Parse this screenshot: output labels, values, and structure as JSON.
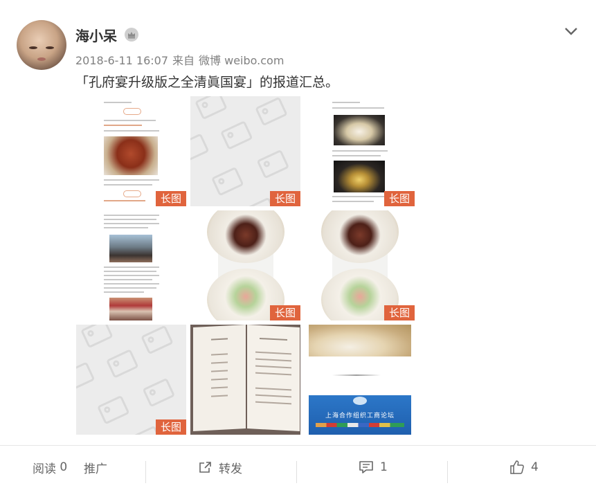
{
  "post": {
    "username": "海小呆",
    "date": "2018-6-11 16:07",
    "from_prefix": "来自",
    "source": "微博 weibo.com",
    "text": "「孔府宴升级版之全清眞国宴」的报道汇总。"
  },
  "images": [
    {
      "badge": "长图",
      "kind": "doc-food"
    },
    {
      "badge": "长图",
      "kind": "placeholder"
    },
    {
      "badge": "长图",
      "kind": "doc-dishes"
    },
    {
      "badge": "",
      "kind": "doc-photos"
    },
    {
      "badge": "长图",
      "kind": "plates"
    },
    {
      "badge": "长图",
      "kind": "plates"
    },
    {
      "badge": "长图",
      "kind": "placeholder"
    },
    {
      "badge": "",
      "kind": "menu"
    },
    {
      "badge": "",
      "kind": "banquet"
    }
  ],
  "banner": {
    "title": "上海合作组织工商论坛"
  },
  "footer": {
    "reads_label": "阅读",
    "reads_count": "0",
    "promote_label": "推广",
    "share_label": "转发",
    "comment_count": "1",
    "like_count": "4"
  },
  "colors": {
    "badge": "#e0643d",
    "text": "#333333",
    "meta": "#808080"
  },
  "icons": [
    "crown-icon",
    "chevron-down-icon",
    "share-icon",
    "comment-icon",
    "like-icon"
  ]
}
